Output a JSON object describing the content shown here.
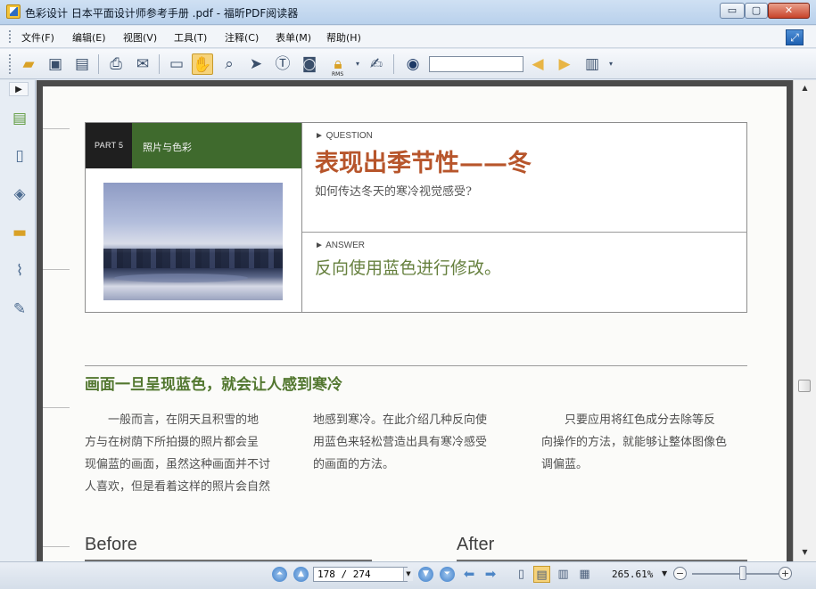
{
  "window": {
    "title": "色彩设计  日本平面设计师参考手册 .pdf - 福昕PDF阅读器",
    "minimize_glyph": "▭",
    "maximize_glyph": "▢",
    "close_glyph": "✕"
  },
  "menu": {
    "items": [
      "文件(F)",
      "编辑(E)",
      "视图(V)",
      "工具(T)",
      "注释(C)",
      "表单(M)",
      "帮助(H)"
    ]
  },
  "toolbar": {
    "icons": [
      "open-folder-icon",
      "save-icon",
      "save-all-icon",
      "print-icon",
      "email-icon",
      "full-screen-icon",
      "hand-tool-icon",
      "zoom-tool-icon",
      "select-arrow-icon",
      "text-select-icon",
      "snapshot-icon",
      "rms-lock-icon",
      "sign-icon",
      "find-binoculars-icon",
      "previous-result-icon",
      "next-result-icon",
      "search-options-icon"
    ],
    "rms_label": "RMS",
    "search_value": ""
  },
  "document": {
    "part_label": "PART 5",
    "part_title": "照片与色彩",
    "question_label": "► QUESTION",
    "question_title": "表现出季节性——冬",
    "question_subtitle": "如何传达冬天的寒冷视觉感受?",
    "answer_label": "► ANSWER",
    "answer_text": "反向使用蓝色进行修改。",
    "section_heading": "画面一旦呈现蓝色，就会让人感到寒冷",
    "columns": [
      [
        "　　一般而言，在阴天且积雪的地",
        "方与在树荫下所拍摄的照片都会呈",
        "现偏蓝的画面，虽然这种画面并不讨",
        "人喜欢，但是看着这样的照片会自然"
      ],
      [
        "地感到寒冷。在此介绍几种反向使",
        "用蓝色来轻松营造出具有寒冷感受",
        "的画面的方法。"
      ],
      [
        "　　只要应用将红色成分去除等反",
        "向操作的方法，就能够让整体图像色",
        "调偏蓝。"
      ]
    ],
    "before_label": "Before",
    "after_label": "After"
  },
  "status": {
    "page_value": "178 / 274",
    "current_page": 178,
    "total_pages": 274,
    "zoom": "265.61%",
    "zoom_minus": "−",
    "zoom_plus": "+"
  },
  "colors": {
    "accent_green": "#3f6a2d",
    "title_orange": "#b7552b",
    "answer_green": "#66803e"
  }
}
